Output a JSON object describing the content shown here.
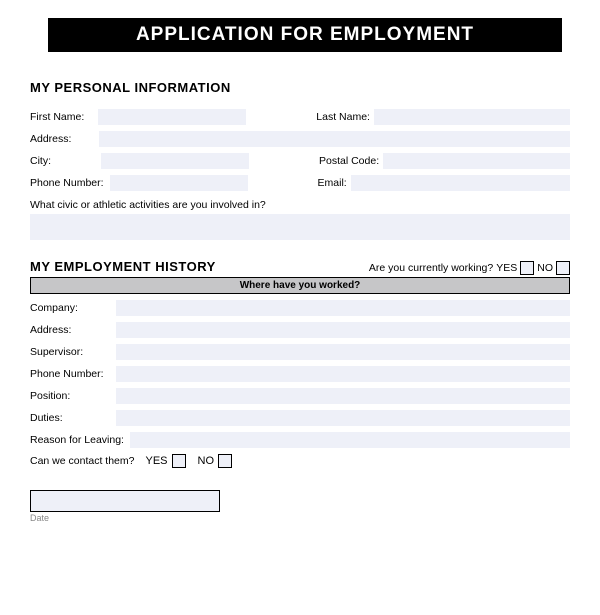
{
  "title": "APPLICATION FOR EMPLOYMENT",
  "personal": {
    "heading": "MY PERSONAL INFORMATION",
    "first_name_label": "First Name:",
    "last_name_label": "Last Name:",
    "address_label": "Address:",
    "city_label": "City:",
    "postal_label": "Postal Code:",
    "phone_label": "Phone Number:",
    "email_label": "Email:",
    "activities_label": "What civic or athletic activities are you involved in?",
    "first_name": "",
    "last_name": "",
    "address": "",
    "city": "",
    "postal": "",
    "phone": "",
    "email": "",
    "activities": ""
  },
  "history": {
    "heading": "MY EMPLOYMENT HISTORY",
    "working_q": "Are you currently working?",
    "yes": "YES",
    "no": "NO",
    "banner": "Where have you worked?",
    "company_label": "Company:",
    "address_label": "Address:",
    "supervisor_label": "Supervisor:",
    "phone_label": "Phone Number:",
    "position_label": "Position:",
    "duties_label": "Duties:",
    "reason_label": "Reason for Leaving:",
    "contact_q": "Can we contact them?",
    "company": "",
    "address": "",
    "supervisor": "",
    "phone": "",
    "position": "",
    "duties": "",
    "reason": ""
  },
  "date": {
    "caption": "Date",
    "value": ""
  }
}
